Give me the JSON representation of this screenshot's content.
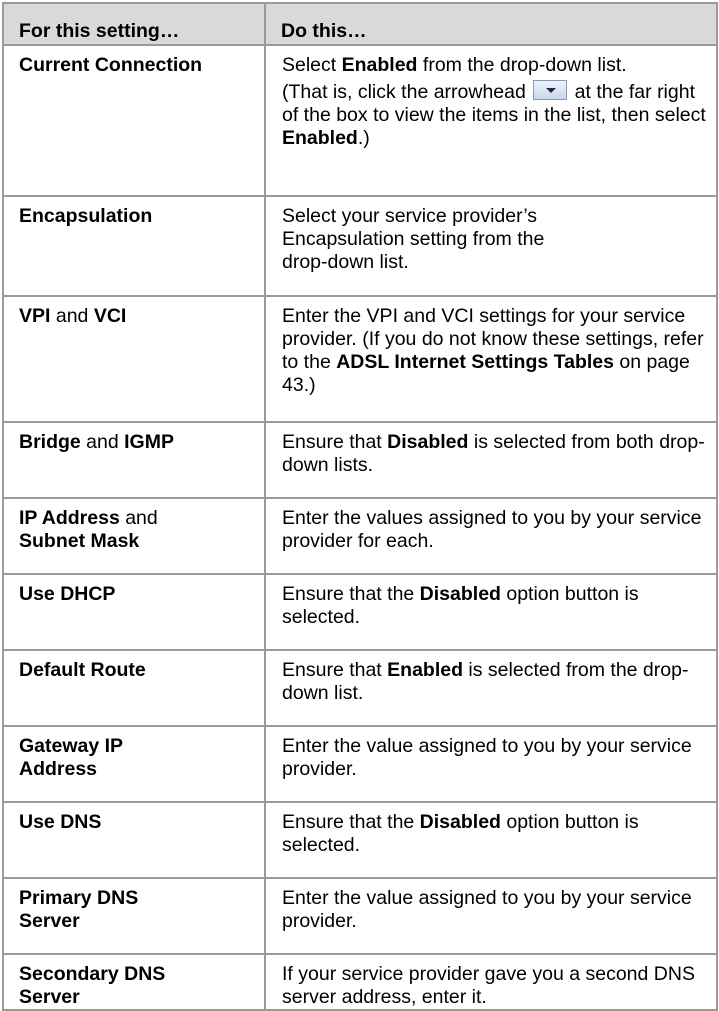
{
  "table": {
    "header": {
      "setting": "For this setting…",
      "action": "Do this…"
    },
    "rows": [
      {
        "setting": "Current Connection",
        "action_p1_pre": "Select ",
        "action_p1_b1": "Enabled",
        "action_p1_post": " from the drop-down list.",
        "action_p2_pre": "(That is, click the arrowhead ",
        "action_p2_icon": "dropdown-arrow-icon",
        "action_p2_mid": " at the far right of the box to view the items in the list, then select ",
        "action_p2_b1": "Enabled",
        "action_p2_post": ".)"
      },
      {
        "setting": "Encapsulation",
        "action": "Select your service provider’s Encapsulation setting from the drop-down list."
      },
      {
        "setting_b1": "VPI",
        "setting_plain": " and ",
        "setting_b2": "VCI",
        "action_pre": "Enter the VPI and VCI settings for your service provider. (If you do not know these settings, refer to the ",
        "action_b1": "ADSL Internet Settings Tables",
        "action_post": " on page 43.)"
      },
      {
        "setting_b1": "Bridge",
        "setting_plain": " and ",
        "setting_b2": "IGMP",
        "action_pre": "Ensure that ",
        "action_b1": "Disabled",
        "action_post": " is selected from both drop-down lists."
      },
      {
        "setting_b1": "IP Address",
        "setting_plain": " and ",
        "setting_b2": "Subnet Mask",
        "action": "Enter the values assigned to you by your service provider for each."
      },
      {
        "setting": "Use DHCP",
        "action_pre": "Ensure that the ",
        "action_b1": "Disabled",
        "action_post": " option button is selected."
      },
      {
        "setting": "Default Route",
        "action_pre": "Ensure that ",
        "action_b1": "Enabled",
        "action_post": " is selected from the drop-down list."
      },
      {
        "setting": "Gateway IP Address",
        "action": "Enter the value assigned to you by your service provider."
      },
      {
        "setting": "Use DNS",
        "action_pre": "Ensure that the ",
        "action_b1": "Disabled",
        "action_post": " option button is selected."
      },
      {
        "setting": "Primary DNS Server",
        "action": "Enter the value assigned to you by your service provider."
      },
      {
        "setting": "Secondary DNS Server",
        "action": "If your service provider gave you a second DNS server address, enter it."
      }
    ]
  },
  "colors": {
    "header_bg": "#d9d9d9",
    "border": "#9a9a9a",
    "text": "#000000"
  }
}
